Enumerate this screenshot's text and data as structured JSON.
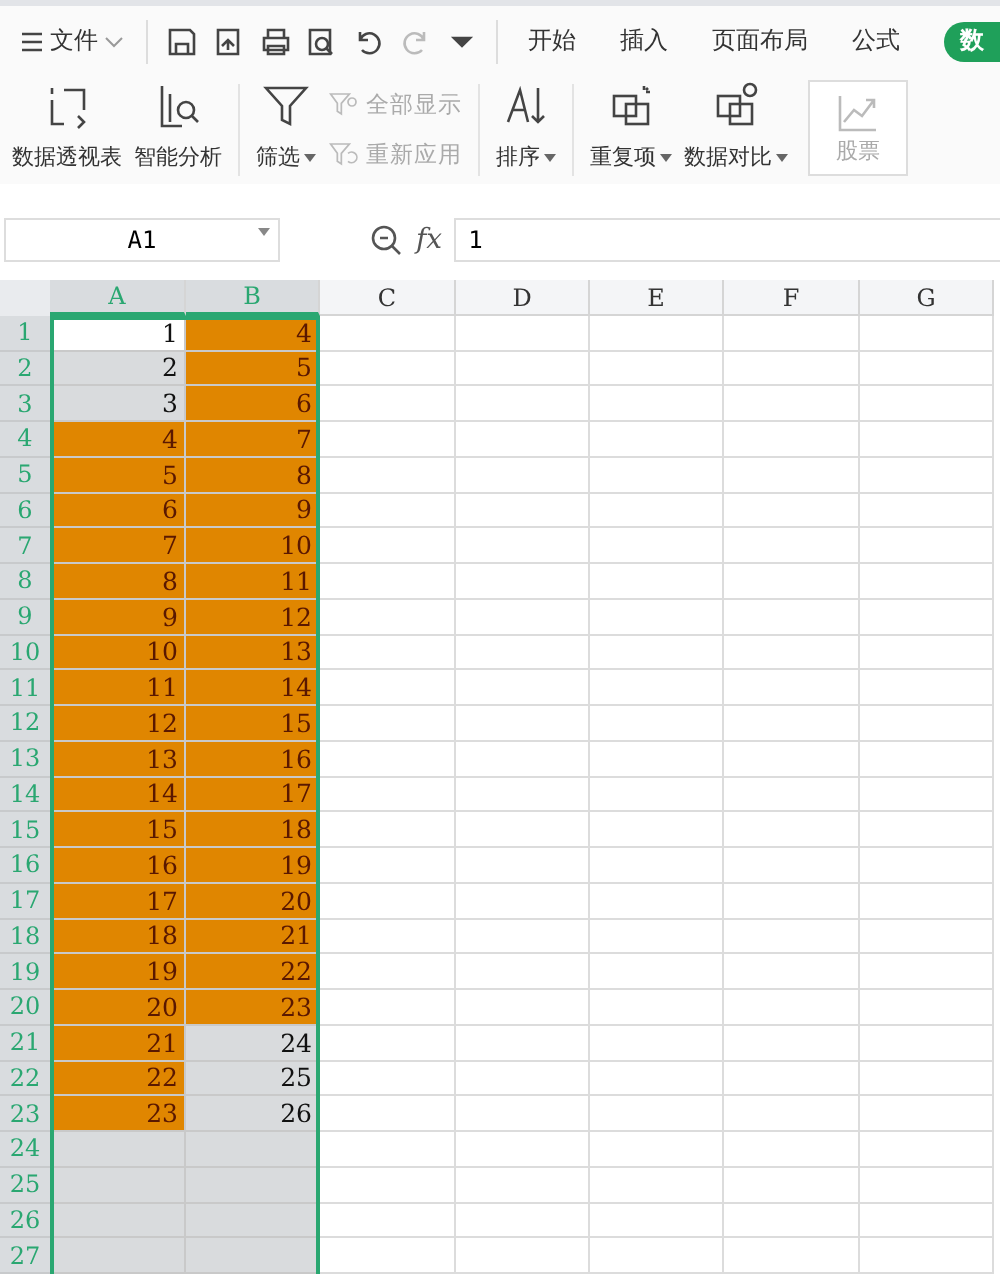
{
  "menu": {
    "label": "文件"
  },
  "tabs": [
    {
      "label": "开始",
      "selected": false
    },
    {
      "label": "插入",
      "selected": false
    },
    {
      "label": "页面布局",
      "selected": false
    },
    {
      "label": "公式",
      "selected": false
    },
    {
      "label": "数",
      "selected": true
    }
  ],
  "ribbon": [
    {
      "kind": "big",
      "label": "数据透视表",
      "dropdown": false
    },
    {
      "kind": "big",
      "label": "智能分析",
      "dropdown": false
    },
    {
      "kind": "sep"
    },
    {
      "kind": "big",
      "label": "筛选",
      "dropdown": true
    },
    {
      "kind": "stack",
      "items": [
        {
          "label": "全部显示",
          "disabled": true
        },
        {
          "label": "重新应用",
          "disabled": true
        }
      ]
    },
    {
      "kind": "sep"
    },
    {
      "kind": "big",
      "label": "排序",
      "dropdown": true
    },
    {
      "kind": "sep"
    },
    {
      "kind": "big",
      "label": "重复项",
      "dropdown": true
    },
    {
      "kind": "big",
      "label": "数据对比",
      "dropdown": true
    },
    {
      "kind": "boxed",
      "label": "股票",
      "disabled": true
    }
  ],
  "formula_bar": {
    "cell_ref": "A1",
    "fx_label": "fx",
    "value": "1"
  },
  "columns": [
    {
      "label": "A",
      "selected": true
    },
    {
      "label": "B",
      "selected": true
    },
    {
      "label": "C",
      "selected": false
    },
    {
      "label": "D",
      "selected": false
    },
    {
      "label": "E",
      "selected": false
    },
    {
      "label": "F",
      "selected": false
    },
    {
      "label": "G",
      "selected": false
    }
  ],
  "rows": [
    {
      "header": "1",
      "cells": [
        {
          "text": "1",
          "highlighted": false,
          "active": true
        },
        {
          "text": "4",
          "highlighted": true
        }
      ]
    },
    {
      "header": "2",
      "cells": [
        {
          "text": "2",
          "highlighted": false
        },
        {
          "text": "5",
          "highlighted": true
        }
      ]
    },
    {
      "header": "3",
      "cells": [
        {
          "text": "3",
          "highlighted": false
        },
        {
          "text": "6",
          "highlighted": true
        }
      ]
    },
    {
      "header": "4",
      "cells": [
        {
          "text": "4",
          "highlighted": true
        },
        {
          "text": "7",
          "highlighted": true
        }
      ]
    },
    {
      "header": "5",
      "cells": [
        {
          "text": "5",
          "highlighted": true
        },
        {
          "text": "8",
          "highlighted": true
        }
      ]
    },
    {
      "header": "6",
      "cells": [
        {
          "text": "6",
          "highlighted": true
        },
        {
          "text": "9",
          "highlighted": true
        }
      ]
    },
    {
      "header": "7",
      "cells": [
        {
          "text": "7",
          "highlighted": true
        },
        {
          "text": "10",
          "highlighted": true
        }
      ]
    },
    {
      "header": "8",
      "cells": [
        {
          "text": "8",
          "highlighted": true
        },
        {
          "text": "11",
          "highlighted": true
        }
      ]
    },
    {
      "header": "9",
      "cells": [
        {
          "text": "9",
          "highlighted": true
        },
        {
          "text": "12",
          "highlighted": true
        }
      ]
    },
    {
      "header": "10",
      "cells": [
        {
          "text": "10",
          "highlighted": true
        },
        {
          "text": "13",
          "highlighted": true
        }
      ]
    },
    {
      "header": "11",
      "cells": [
        {
          "text": "11",
          "highlighted": true
        },
        {
          "text": "14",
          "highlighted": true
        }
      ]
    },
    {
      "header": "12",
      "cells": [
        {
          "text": "12",
          "highlighted": true
        },
        {
          "text": "15",
          "highlighted": true
        }
      ]
    },
    {
      "header": "13",
      "cells": [
        {
          "text": "13",
          "highlighted": true
        },
        {
          "text": "16",
          "highlighted": true
        }
      ]
    },
    {
      "header": "14",
      "cells": [
        {
          "text": "14",
          "highlighted": true
        },
        {
          "text": "17",
          "highlighted": true
        }
      ]
    },
    {
      "header": "15",
      "cells": [
        {
          "text": "15",
          "highlighted": true
        },
        {
          "text": "18",
          "highlighted": true
        }
      ]
    },
    {
      "header": "16",
      "cells": [
        {
          "text": "16",
          "highlighted": true
        },
        {
          "text": "19",
          "highlighted": true
        }
      ]
    },
    {
      "header": "17",
      "cells": [
        {
          "text": "17",
          "highlighted": true
        },
        {
          "text": "20",
          "highlighted": true
        }
      ]
    },
    {
      "header": "18",
      "cells": [
        {
          "text": "18",
          "highlighted": true
        },
        {
          "text": "21",
          "highlighted": true
        }
      ]
    },
    {
      "header": "19",
      "cells": [
        {
          "text": "19",
          "highlighted": true
        },
        {
          "text": "22",
          "highlighted": true
        }
      ]
    },
    {
      "header": "20",
      "cells": [
        {
          "text": "20",
          "highlighted": true
        },
        {
          "text": "23",
          "highlighted": true
        }
      ]
    },
    {
      "header": "21",
      "cells": [
        {
          "text": "21",
          "highlighted": true
        },
        {
          "text": "24",
          "highlighted": false
        }
      ]
    },
    {
      "header": "22",
      "cells": [
        {
          "text": "22",
          "highlighted": true
        },
        {
          "text": "25",
          "highlighted": false
        }
      ]
    },
    {
      "header": "23",
      "cells": [
        {
          "text": "23",
          "highlighted": true
        },
        {
          "text": "26",
          "highlighted": false
        }
      ]
    },
    {
      "header": "24",
      "cells": [
        {
          "highlighted": false
        },
        {
          "highlighted": false
        }
      ]
    },
    {
      "header": "25",
      "cells": [
        {
          "highlighted": false
        },
        {
          "highlighted": false
        }
      ]
    },
    {
      "header": "26",
      "cells": [
        {
          "highlighted": false
        },
        {
          "highlighted": false
        }
      ]
    },
    {
      "header": "27",
      "cells": [
        {
          "highlighted": false
        },
        {
          "highlighted": false
        }
      ]
    }
  ]
}
